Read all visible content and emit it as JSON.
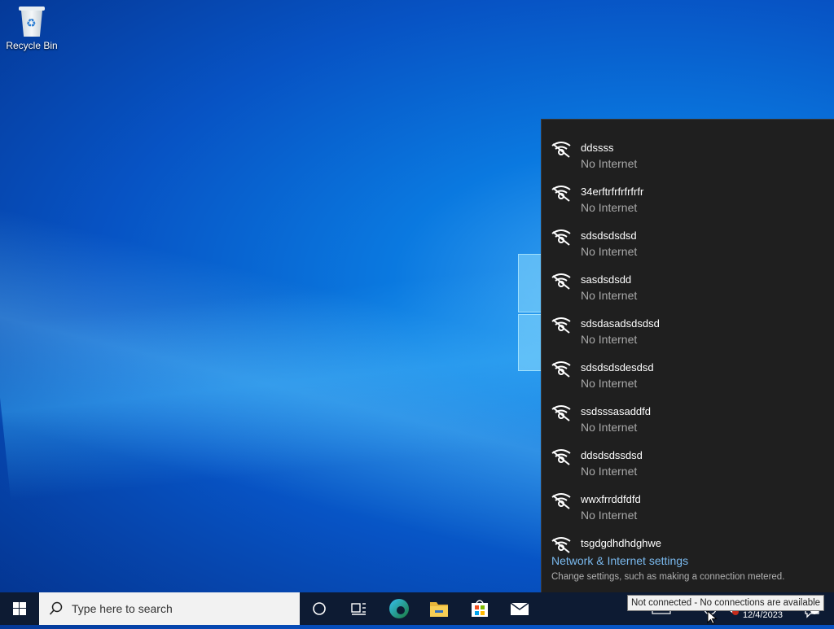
{
  "desktop": {
    "icons": [
      {
        "label": "Recycle Bin",
        "icon": "recycle-bin-icon"
      }
    ]
  },
  "network_flyout": {
    "networks": [
      {
        "ssid": "ddssss",
        "status": "No Internet"
      },
      {
        "ssid": "34erftrfrfrfrfrfr",
        "status": "No Internet"
      },
      {
        "ssid": "sdsdsdsdsd",
        "status": "No Internet"
      },
      {
        "ssid": "sasdsdsdd",
        "status": "No Internet"
      },
      {
        "ssid": "sdsdasadsdsdsd",
        "status": "No Internet"
      },
      {
        "ssid": "sdsdsdsdesdsd",
        "status": "No Internet"
      },
      {
        "ssid": "ssdsssasaddfd",
        "status": "No Internet"
      },
      {
        "ssid": "ddsdsdssdsd",
        "status": "No Internet"
      },
      {
        "ssid": "wwxfrrddfdfd",
        "status": "No Internet"
      },
      {
        "ssid": "tsgdgdhdhdghwe",
        "status": ""
      }
    ],
    "settings_link": "Network & Internet settings",
    "settings_description": "Change settings, such as making a connection metered."
  },
  "taskbar": {
    "search_placeholder": "Type here to search",
    "apps": [
      "cortana-icon",
      "task-view-icon",
      "edge-icon",
      "file-explorer-icon",
      "store-icon",
      "mail-icon"
    ],
    "date": "12/4/2023",
    "tooltip": "Not connected - No connections are available"
  },
  "colors": {
    "flyout_bg": "#1f1f1f",
    "link": "#7ab9ee",
    "taskbar_bg": "#0d1b33"
  }
}
